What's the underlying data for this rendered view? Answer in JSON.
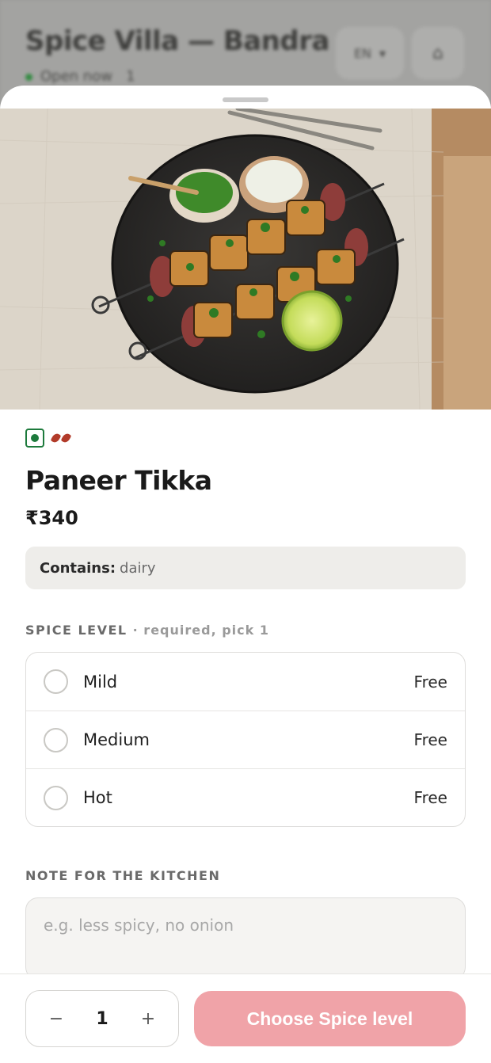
{
  "background_page": {
    "restaurant_name": "Spice Villa — Bandra",
    "status": "Open now",
    "status_extra": "1",
    "language": "EN",
    "cart_icon": "bag-icon"
  },
  "item": {
    "diet": "veg",
    "spice_icons": 2,
    "name": "Paneer Tikka",
    "price": "₹340",
    "allergen_label": "Contains:",
    "allergen_value": "dairy"
  },
  "spice_section": {
    "title": "SPICE LEVEL",
    "subtitle": "· required, pick 1",
    "options": [
      {
        "label": "Mild",
        "price": "Free"
      },
      {
        "label": "Medium",
        "price": "Free"
      },
      {
        "label": "Hot",
        "price": "Free"
      }
    ]
  },
  "note_section": {
    "title": "NOTE FOR THE KITCHEN",
    "placeholder": "e.g. less spicy, no onion"
  },
  "footer": {
    "minus": "−",
    "quantity": "1",
    "plus": "+",
    "cta_label": "Choose Spice level"
  },
  "colors": {
    "veg_green": "#1d7a3c",
    "cta_disabled": "#f0a3a8",
    "chili_red": "#b23b2a"
  }
}
